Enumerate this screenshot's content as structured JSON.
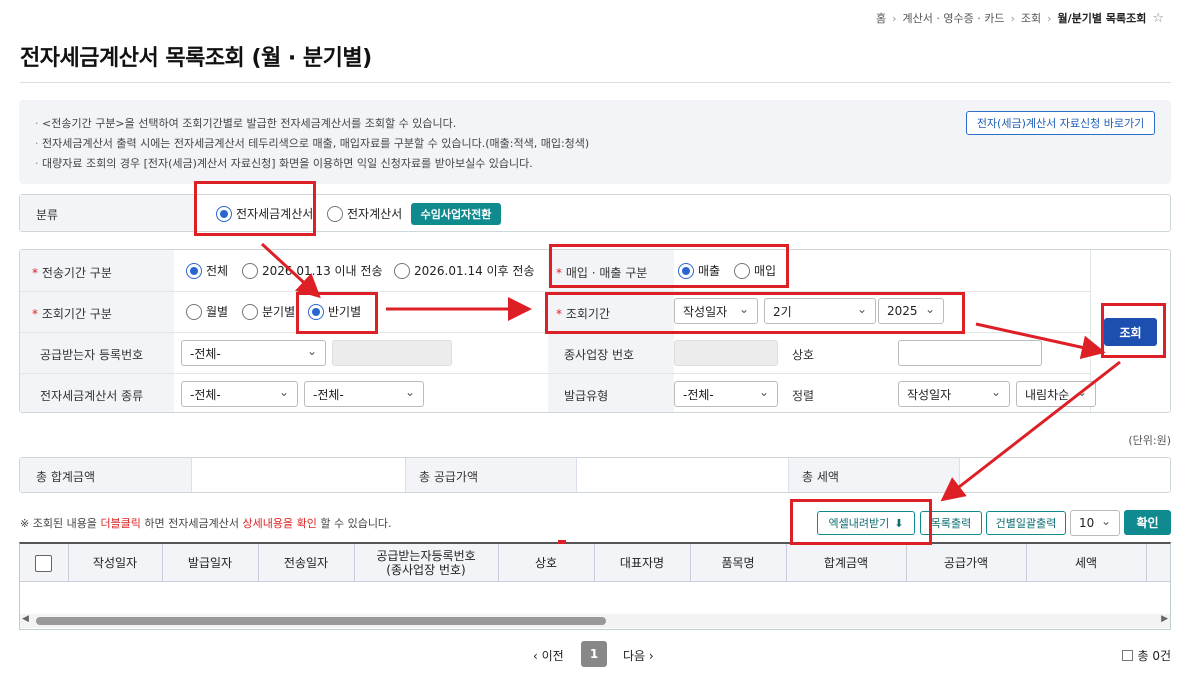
{
  "breadcrumb": {
    "items": [
      "홈",
      "계산서 · 영수증 · 카드",
      "조회"
    ],
    "current": "월/분기별 목록조회"
  },
  "page": {
    "title": "전자세금계산서 목록조회 (월 · 분기별)"
  },
  "notice": {
    "lines": [
      "<전송기간 구분>을 선택하여 조회기간별로 발급한 전자세금계산서를 조회할 수 있습니다.",
      "전자세금계산서 출력 시에는 전자세금계산서 테두리색으로 매출, 매입자료를 구분할 수 있습니다.(매출:적색, 매입:청색)",
      "대량자료 조회의 경우 [전자(세금)계산서 자료신청] 화면을 이용하면 익일 신청자료를 받아보실수 있습니다."
    ],
    "shortcut_label": "전자(세금)계산서 자료신청 바로가기"
  },
  "category": {
    "label": "분류",
    "opt1": "전자세금계산서",
    "opt2": "전자계산서",
    "switch_label": "수임사업자전환"
  },
  "form": {
    "period_type_label": "전송기간 구분",
    "period_all": "전체",
    "period_before": "2026.01.13 이내 전송",
    "period_after": "2026.01.14 이후 전송",
    "trade_label": "매입 · 매출 구분",
    "trade_sale": "매출",
    "trade_buy": "매입",
    "query_type_label": "조회기간 구분",
    "query_month": "월별",
    "query_quarter": "분기별",
    "query_half": "반기별",
    "query_period_label": "조회기간",
    "date_type": "작성일자",
    "half_value": "2기",
    "year_value": "2025",
    "receiver_label": "공급받는자 등록번호",
    "receiver_select": "-전체-",
    "branch_label": "종사업장 번호",
    "company_label": "상호",
    "kind_label": "전자세금계산서 종류",
    "kind_select1": "-전체-",
    "kind_select2": "-전체-",
    "issue_type_label": "발급유형",
    "issue_type_select": "-전체-",
    "sort_label": "정렬",
    "sort_field": "작성일자",
    "sort_order": "내림차순",
    "search_button": "조회"
  },
  "summary": {
    "unit": "(단위:원)",
    "total_label": "총 합계금액",
    "supply_label": "총 공급가액",
    "tax_label": "총 세액"
  },
  "list": {
    "hint_prefix": "※ 조회된 내용을 ",
    "hint_dbl": "더블클릭",
    "hint_mid": " 하면 전자세금계산서 ",
    "hint_detail": "상세내용을 확인",
    "hint_suffix": " 할 수 있습니다.",
    "excel_button": "엑셀내려받기",
    "print_button": "목록출력",
    "bulk_button": "건별일괄출력",
    "page_size": "10",
    "confirm_button": "확인",
    "columns": [
      "작성일자",
      "발급일자",
      "전송일자",
      "공급받는자등록번호",
      "상호",
      "대표자명",
      "품목명",
      "합계금액",
      "공급가액",
      "세액"
    ],
    "column4_sub": "(종사업장 번호)"
  },
  "pagination": {
    "prev": "이전",
    "page": "1",
    "next": "다음",
    "total": "총 0건"
  },
  "colors": {
    "accent": "#0f8a8e",
    "primary": "#1d4fb0",
    "highlight": "#dd1f26"
  }
}
